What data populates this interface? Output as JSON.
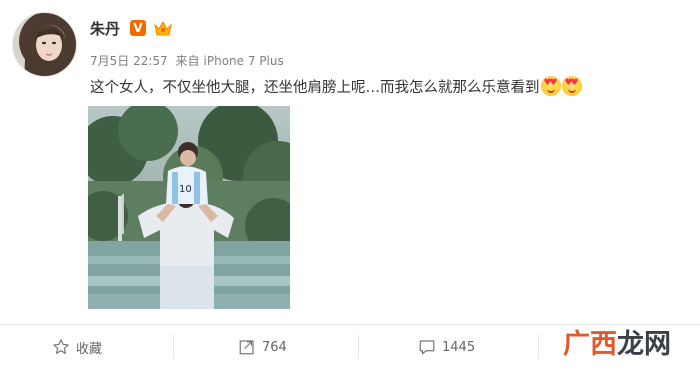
{
  "user": {
    "name": "朱丹",
    "verified_badge": "V"
  },
  "post": {
    "date": "7月5日 22:57",
    "source_prefix": "来自",
    "source": "iPhone 7 Plus",
    "text": "这个女人，不仅坐他大腿，还坐他肩膀上呢…而我怎么就那么乐意看到"
  },
  "actions": {
    "favorite_label": "收藏",
    "repost_count": "764",
    "comment_count": "1445"
  },
  "watermark": {
    "part1": "广西",
    "part2": "龙网"
  },
  "colors": {
    "accent": "#f56a00",
    "text": "#333333",
    "meta": "#808080"
  }
}
